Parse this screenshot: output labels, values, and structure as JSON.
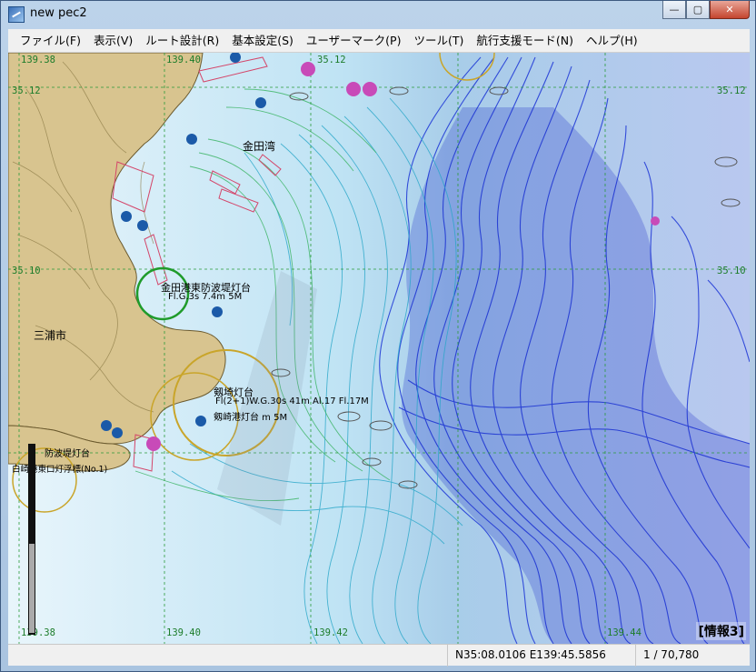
{
  "window": {
    "title": "new pec2",
    "min_icon": "minimize-icon",
    "max_icon": "maximize-icon",
    "close_icon": "close-icon",
    "min_glyph": "—",
    "max_glyph": "▢",
    "close_glyph": "✕"
  },
  "menu": [
    "ファイル(F)",
    "表示(V)",
    "ルート設計(R)",
    "基本設定(S)",
    "ユーザーマーク(P)",
    "ツール(T)",
    "航行支援モード(N)",
    "ヘルプ(H)"
  ],
  "map": {
    "grid_labels": {
      "top_left": "139.38",
      "top_mid1": "139.40",
      "top_mid2": "35.12",
      "lat_top_left": "35.12",
      "lat_top_right": "35.12",
      "lat_mid_left": "35.10",
      "lat_mid_right": "35.10",
      "bottom_1": "139.38",
      "bottom_2": "139.40",
      "bottom_3": "139.42",
      "bottom_4": "139.44"
    },
    "place_names": {
      "bay": "金田湾",
      "city": "三浦市",
      "lighthouse1": "金田港東防波堤灯台",
      "lighthouse1_detail": "Fl.G.3s 7.4m 5M",
      "lighthouse2": "剱埼灯台",
      "lighthouse2_detail": "Fl(2+1)W.G.30s 41m Al.17 Fl.17M",
      "lighthouse3": "剱崎港灯台 m 5M",
      "harbor_left1": "防波堤灯台",
      "harbor_left2": "白崎港東口灯浮標(No.1)"
    },
    "info_badge": "[情報3]",
    "colors": {
      "land": "#d8c48f",
      "shallow": "#e9f5fb",
      "deep": "#1a2fd0",
      "grid": "#2a9a3a"
    }
  },
  "status": {
    "empty": "",
    "coordinates": "N35:08.0106 E139:45.5856",
    "scale": "1 / 70,780"
  }
}
